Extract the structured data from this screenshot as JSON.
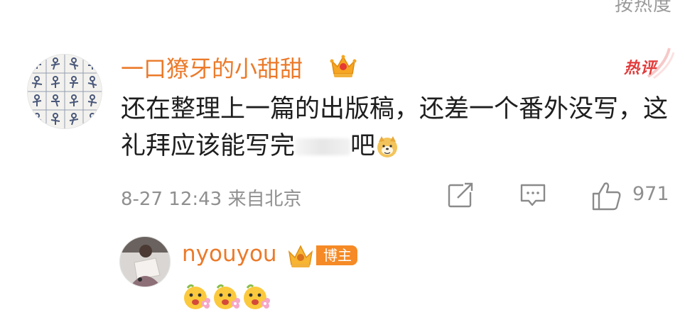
{
  "sort": {
    "label": "​​​​​​按热度"
  },
  "comment": {
    "username": "一口獠牙的小甜甜",
    "badge": "热评",
    "text_part1": "还在整理上一篇的出版稿，还差一个番外没写，这礼拜应该能写完",
    "text_part2": "吧",
    "date_location": "8-27 12:43 来自北京",
    "like_count": "971"
  },
  "reply": {
    "username": "nyouyou",
    "tag": "博主",
    "emoji_count": 3
  },
  "icons": {
    "crown": "vip-crown-icon",
    "share": "share-icon",
    "comment": "comment-icon",
    "like": "thumbs-up-icon"
  }
}
